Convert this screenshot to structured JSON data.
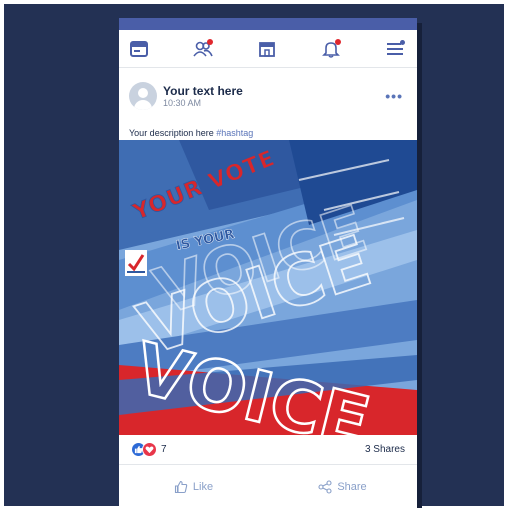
{
  "post": {
    "author": "Your text here",
    "time": "10:30 AM",
    "more": "•••",
    "description": "Your description here",
    "hashtag": "#hashtag"
  },
  "poster": {
    "line1": "YOUR VOTE",
    "line2": "IS YOUR",
    "word": "VOICE"
  },
  "stats": {
    "reaction_count": "7",
    "shares": "3 Shares"
  },
  "actions": {
    "like": "Like",
    "share": "Share"
  },
  "nav": {
    "icons": [
      "browser-icon",
      "friends-icon",
      "store-icon",
      "bell-icon",
      "menu-icon"
    ],
    "badge_color": "#e0282e"
  },
  "colors": {
    "background": "#233154",
    "accent": "#4a5ea8",
    "link": "#5a74b8",
    "poster_red": "#d8262b"
  }
}
